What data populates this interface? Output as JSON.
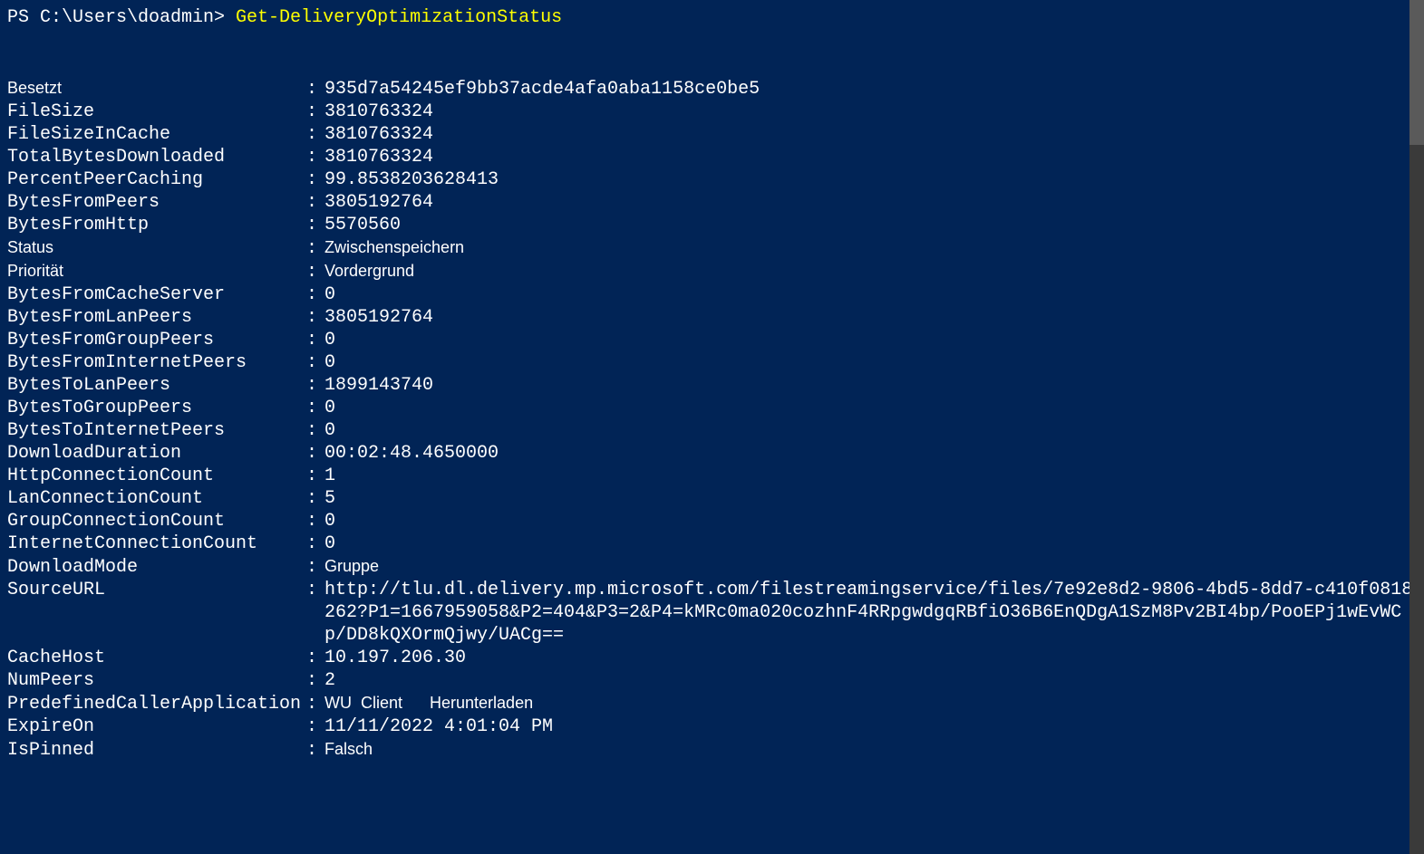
{
  "prompt": "PS C:\\Users\\doadmin> ",
  "command": "Get-DeliveryOptimizationStatus",
  "rows": [
    {
      "key": "Besetzt",
      "value": "935d7a54245ef9bb37acde4afa0aba1158ce0be5",
      "keySans": true
    },
    {
      "key": "FileSize",
      "value": "3810763324"
    },
    {
      "key": "FileSizeInCache",
      "value": "3810763324"
    },
    {
      "key": "TotalBytesDownloaded",
      "value": "3810763324"
    },
    {
      "key": "PercentPeerCaching",
      "value": "99.8538203628413"
    },
    {
      "key": "BytesFromPeers",
      "value": "3805192764"
    },
    {
      "key": "BytesFromHttp",
      "value": "5570560"
    },
    {
      "key": "Status",
      "value": "Zwischenspeichern",
      "keySans": true,
      "valSans": true
    },
    {
      "key": "Priorität",
      "value": "Vordergrund",
      "keySans": true,
      "valSans": true
    },
    {
      "key": "BytesFromCacheServer",
      "value": "0"
    },
    {
      "key": "BytesFromLanPeers",
      "value": "3805192764"
    },
    {
      "key": "BytesFromGroupPeers",
      "value": "0"
    },
    {
      "key": "BytesFromInternetPeers",
      "value": "0"
    },
    {
      "key": "BytesToLanPeers",
      "value": "1899143740"
    },
    {
      "key": "BytesToGroupPeers",
      "value": "0"
    },
    {
      "key": "BytesToInternetPeers",
      "value": "0"
    },
    {
      "key": "DownloadDuration",
      "value": "00:02:48.4650000"
    },
    {
      "key": "HttpConnectionCount",
      "value": "1"
    },
    {
      "key": "LanConnectionCount",
      "value": "5"
    },
    {
      "key": "GroupConnectionCount",
      "value": "0"
    },
    {
      "key": "InternetConnectionCount",
      "value": "0"
    },
    {
      "key": "DownloadMode",
      "value": "Gruppe",
      "valSans": true
    },
    {
      "key": "SourceURL",
      "value": "http://tlu.dl.delivery.mp.microsoft.com/filestreamingservice/files/7e92e8d2-9806-4bd5-8dd7-c410f0818262?P1=1667959058&P2=404&P3=2&P4=kMRc0ma020cozhnF4RRpgwdgqRBfiO36B6EnQDgA1SzM8Pv2BI4bp/PooEPj1wEvWCp/DD8kQXOrmQjwy/UACg=="
    },
    {
      "key": "CacheHost",
      "value": "10.197.206.30"
    },
    {
      "key": "NumPeers",
      "value": "2"
    },
    {
      "key": "PredefinedCallerApplication",
      "value": "WU  Client      Herunterladen",
      "valSans": true
    },
    {
      "key": "ExpireOn",
      "value": "11/11/2022 4:01:04 PM"
    },
    {
      "key": "IsPinned",
      "value": "Falsch",
      "valSans": true
    }
  ]
}
